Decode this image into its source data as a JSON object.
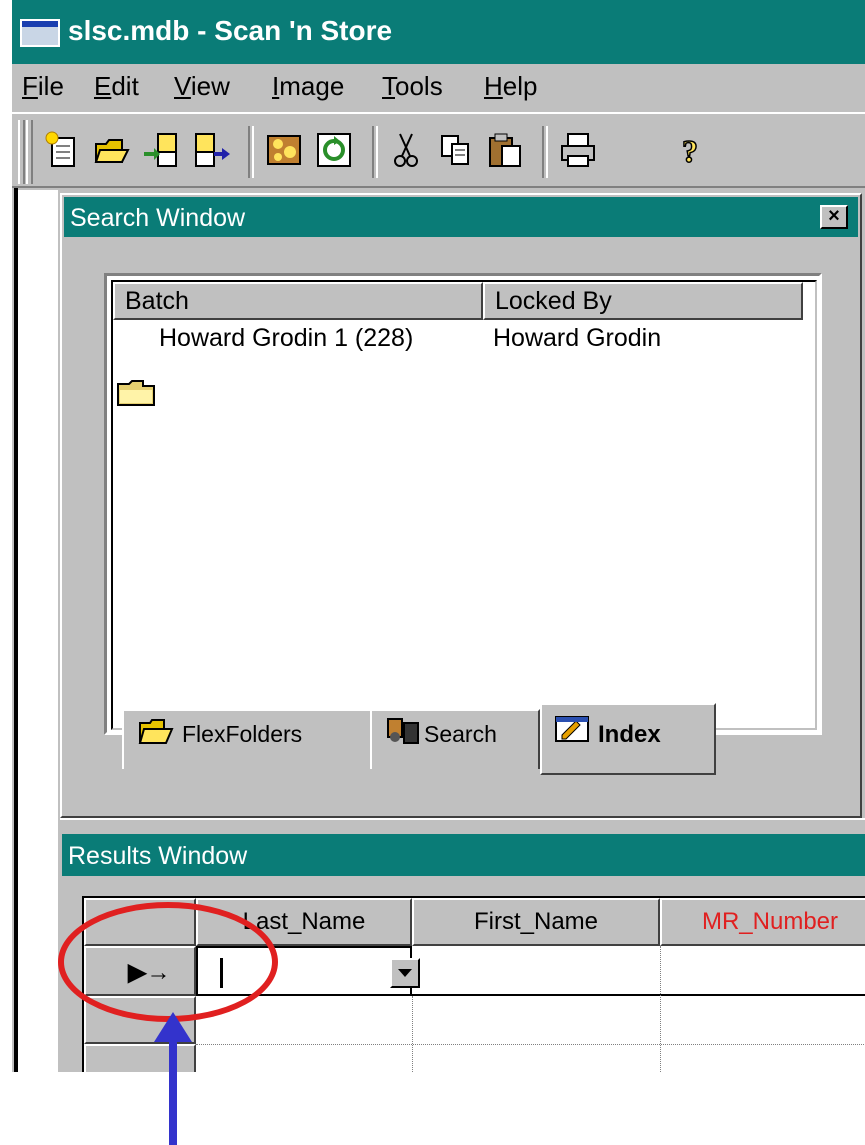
{
  "app": {
    "title": "slsc.mdb - Scan 'n Store",
    "icon": "app-window-icon"
  },
  "menu": {
    "items": [
      {
        "label": "File",
        "underline": "F"
      },
      {
        "label": "Edit",
        "underline": "E"
      },
      {
        "label": "View",
        "underline": "V"
      },
      {
        "label": "Image",
        "underline": "I"
      },
      {
        "label": "Tools",
        "underline": "T"
      },
      {
        "label": "Help",
        "underline": "H"
      }
    ]
  },
  "toolbar": {
    "buttons": [
      "new-document-icon",
      "open-folder-icon",
      "import-icon",
      "export-icon",
      "scan-icon",
      "refresh-icon",
      "cut-icon",
      "copy-icon",
      "paste-icon",
      "print-icon",
      "help-icon"
    ]
  },
  "search_window": {
    "title": "Search Window",
    "close_label": "×",
    "columns": [
      "Batch",
      "Locked By"
    ],
    "rows": [
      {
        "batch": "Howard Grodin 1 (228)",
        "locked_by": "Howard Grodin",
        "icon": "folder-icon"
      }
    ],
    "tabs": [
      {
        "label": "FlexFolders",
        "icon": "open-folder-icon",
        "active": false
      },
      {
        "label": "Search",
        "icon": "binoculars-icon",
        "active": false
      },
      {
        "label": "Index",
        "icon": "index-card-icon",
        "active": true
      }
    ]
  },
  "results_window": {
    "title": "Results Window",
    "columns": [
      {
        "label": "Last_Name",
        "color": "#000000"
      },
      {
        "label": "First_Name",
        "color": "#000000"
      },
      {
        "label": "MR_Number",
        "color": "#e02020"
      }
    ],
    "current_record_indicator": "▶→"
  },
  "annotations": {
    "highlight_color": "#e02020",
    "arrow_color": "#3333cc"
  },
  "colors": {
    "titlebar": "#0a7c77",
    "face": "#c0c0c0"
  }
}
